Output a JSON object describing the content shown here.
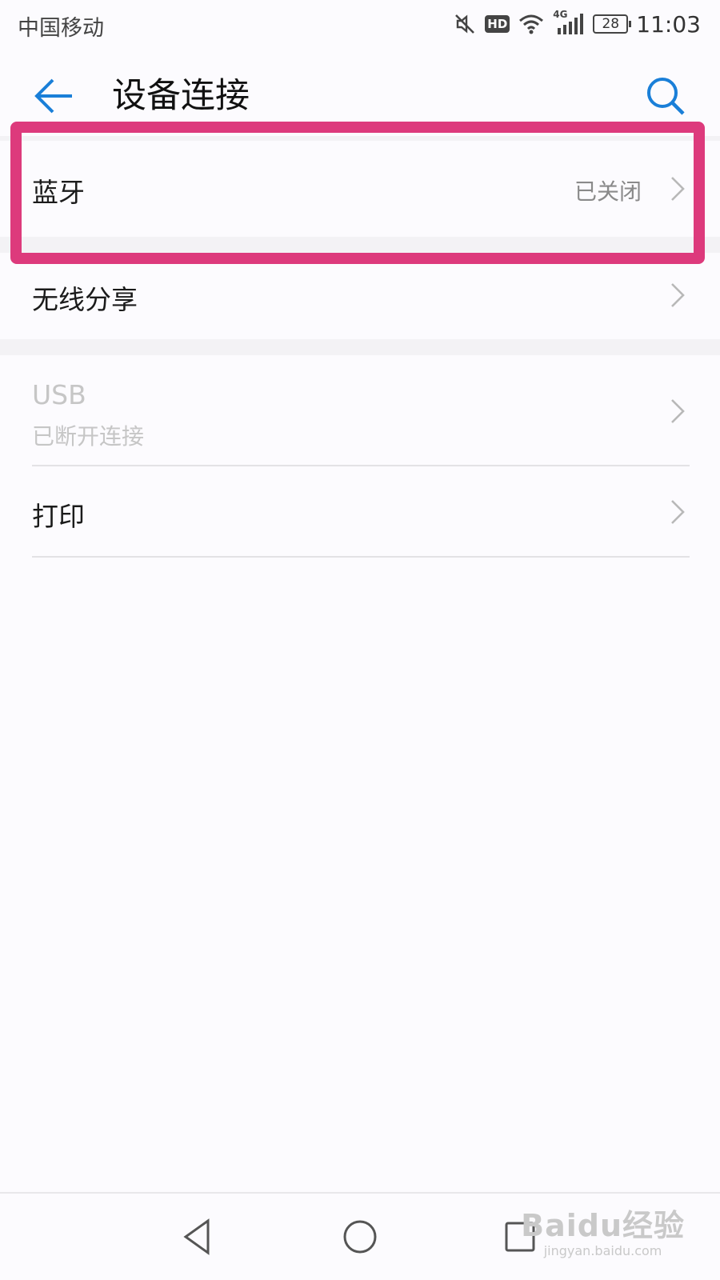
{
  "status_bar": {
    "carrier": "中国移动",
    "hd": "HD",
    "network": "4G",
    "battery": "28",
    "time": "11:03"
  },
  "header": {
    "title": "设备连接"
  },
  "items": [
    {
      "title": "蓝牙",
      "value": "已关闭"
    },
    {
      "title": "无线分享"
    },
    {
      "title": "USB",
      "subtitle": "已断开连接"
    },
    {
      "title": "打印"
    }
  ],
  "watermark": {
    "logo": "Baidu经验",
    "url": "jingyan.baidu.com"
  },
  "colors": {
    "accent": "#1a7fd8",
    "highlight": "#dd3a7c"
  }
}
